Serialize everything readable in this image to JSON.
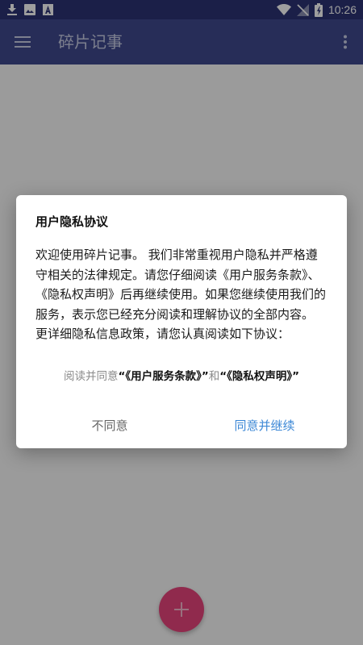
{
  "status_bar": {
    "time": "10:26",
    "left_icons": [
      "download-icon",
      "image-icon",
      "app-notification-icon"
    ],
    "right_icons": [
      "wifi-icon",
      "no-signal-icon",
      "battery-charging-icon"
    ]
  },
  "app_bar": {
    "title": "碎片记事",
    "menu_icon": "hamburger-menu-icon",
    "more_icon": "more-vert-icon"
  },
  "dialog": {
    "title": "用户隐私协议",
    "body_lines": [
      "欢迎使用碎片记事。 我们非常重视用户隐私并严格遵",
      "守相关的法律规定。请您仔细阅读《用户服务条款》、",
      "《隐私权声明》后再继续使用。如果您继续使用我们的",
      "服务，表示您已经充分阅读和理解协议的全部内容。",
      "更详细隐私信息政策，请您认真阅读如下协议："
    ],
    "agree_prefix": "阅读并同意",
    "terms_link": "“《用户服务条款》”",
    "and_text": "和",
    "privacy_link": "“《隐私权声明》”",
    "disagree_label": "不同意",
    "agree_label": "同意并继续"
  },
  "fab": {
    "icon": "plus-icon"
  },
  "colors": {
    "status_bar": "#2c3374",
    "app_bar": "#3f4a8f",
    "fab": "#e8457d",
    "agree_button": "#3d88d6"
  }
}
